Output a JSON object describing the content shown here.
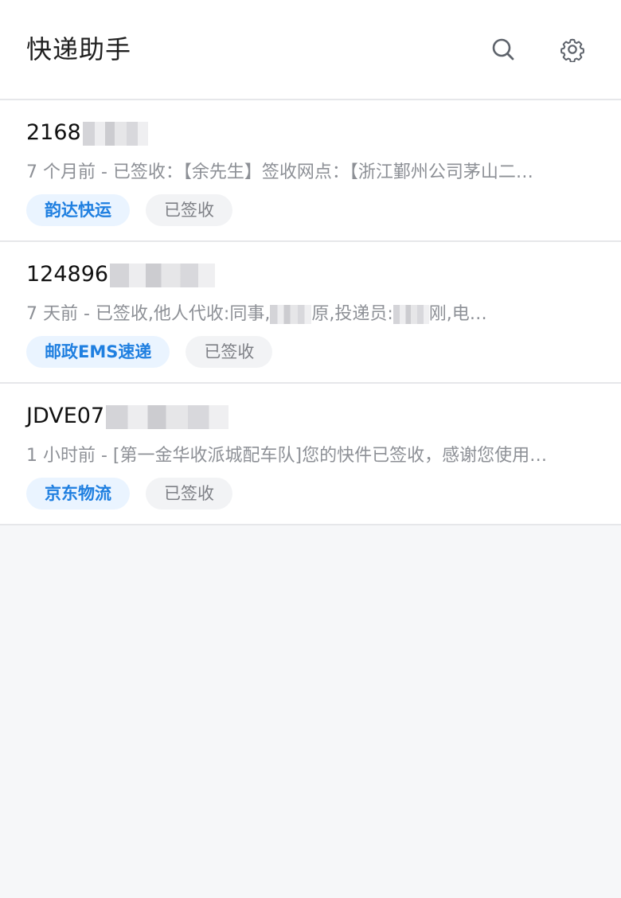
{
  "app": {
    "title": "快递助手"
  },
  "toolbar": {
    "search_icon": "search-icon",
    "settings_icon": "gear-icon"
  },
  "shipments": [
    {
      "tracking_number": "2168",
      "summary": "7 个月前 - 已签收：【余先生】签收网点：【浙江鄞州公司茅山二…",
      "carrier": "韵达快运",
      "status": "已签收"
    },
    {
      "tracking_number": "124896",
      "summary": "7 天前 - 已签收,他人代收:同事,",
      "carrier": "邮政EMS速递",
      "status": "已签收"
    },
    {
      "tracking_number": "JDVE07",
      "summary": "1 小时前 - [第一金华收派城配车队]您的快件已签收，感谢您使用…",
      "carrier": "京东物流",
      "status": "已签收"
    }
  ],
  "colors": {
    "accent": "#1f7fe0",
    "carrier_background": "#eaf4ff",
    "status_background": "#f2f3f5",
    "muted_text": "#8d9096",
    "divider": "#e6e7ea"
  }
}
